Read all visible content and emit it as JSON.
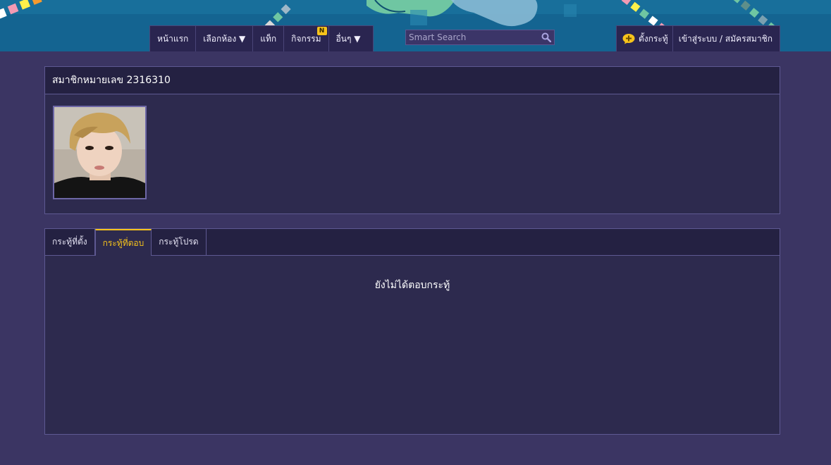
{
  "nav": {
    "home": "หน้าแรก",
    "choose_room": "เลือกห้อง ▼",
    "tag": "แท็ก",
    "activities": "กิจกรรม",
    "activities_badge": "N",
    "more": "อื่นๆ ▼",
    "post_topic": "ตั้งกระทู้",
    "login_register": "เข้าสู่ระบบ / สมัครสมาชิก"
  },
  "search": {
    "placeholder": "Smart Search"
  },
  "profile": {
    "title": "สมาชิกหมายเลข 2316310"
  },
  "tabs": [
    {
      "label": "กระทู้ที่ตั้ง",
      "active": false
    },
    {
      "label": "กระทู้ที่ตอบ",
      "active": true
    },
    {
      "label": "กระทู้โปรด",
      "active": false
    }
  ],
  "empty_message": "ยังไม่ได้ตอบกระทู้",
  "colors": {
    "page_bg": "#3b3563",
    "panel_bg": "#2d2a4e",
    "header_bg": "#242142",
    "accent": "#f6c31b",
    "border": "#5e5992"
  }
}
